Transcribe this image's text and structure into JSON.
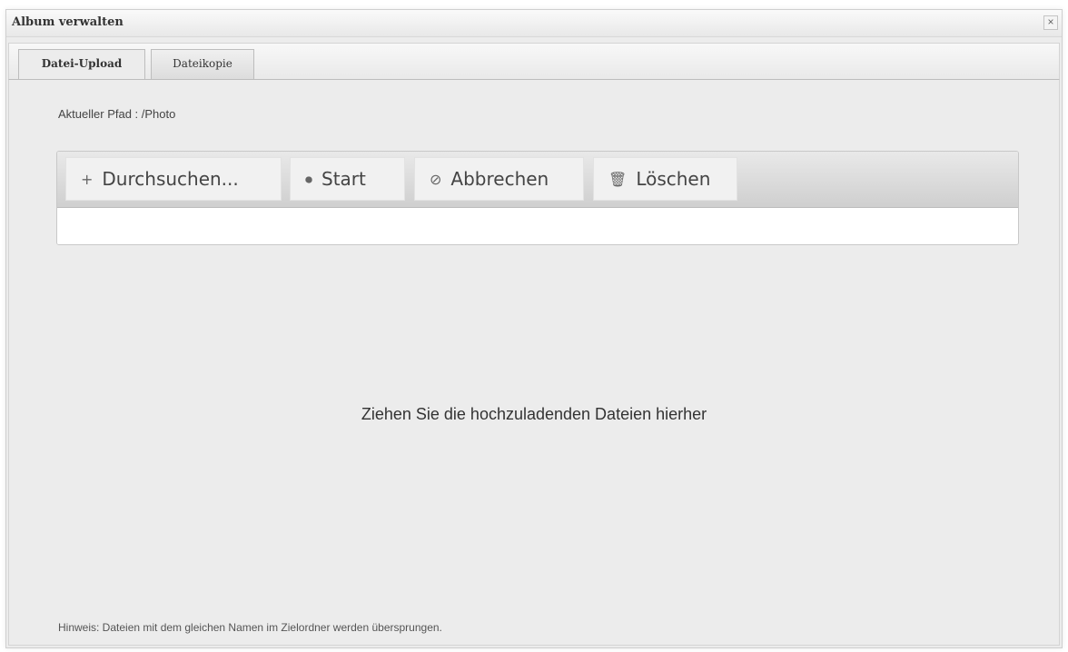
{
  "window": {
    "title": "Album verwalten",
    "close_label": "×"
  },
  "tabs": [
    {
      "label": "Datei-Upload",
      "active": true
    },
    {
      "label": "Dateikopie",
      "active": false
    }
  ],
  "path": {
    "label": "Aktueller Pfad : /Photo"
  },
  "toolbar": {
    "browse_label": "Durchsuchen...",
    "browse_icon": "+",
    "start_label": "Start",
    "start_icon": "⏺",
    "cancel_label": "Abbrechen",
    "cancel_icon": "⊘",
    "delete_label": "Löschen",
    "delete_icon": "🗑"
  },
  "dropzone": {
    "text": "Ziehen Sie die hochzuladenden Dateien hierher"
  },
  "hint": {
    "text": "Hinweis: Dateien mit dem gleichen Namen im Zielordner werden übersprungen."
  }
}
